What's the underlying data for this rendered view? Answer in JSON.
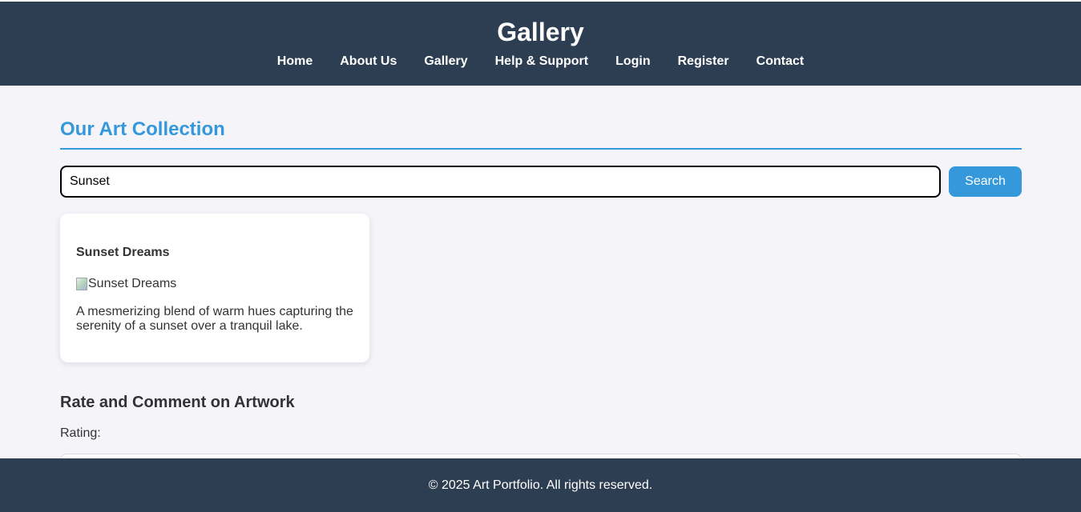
{
  "header": {
    "title": "Gallery",
    "nav": [
      "Home",
      "About Us",
      "Gallery",
      "Help & Support",
      "Login",
      "Register",
      "Contact"
    ]
  },
  "main": {
    "section_title": "Our Art Collection",
    "search": {
      "value": "Sunset",
      "button_label": "Search"
    },
    "artworks": [
      {
        "title": "Sunset Dreams",
        "image_alt": "Sunset Dreams",
        "description": "A mesmerizing blend of warm hues capturing the serenity of a sunset over a tranquil lake."
      }
    ],
    "rate_heading": "Rate and Comment on Artwork",
    "rating_label": "Rating:"
  },
  "footer": {
    "text": "© 2025 Art Portfolio. All rights reserved."
  },
  "colors": {
    "header_bg": "#2e3e52",
    "accent": "#3498db",
    "page_bg": "#f4f4f9"
  }
}
